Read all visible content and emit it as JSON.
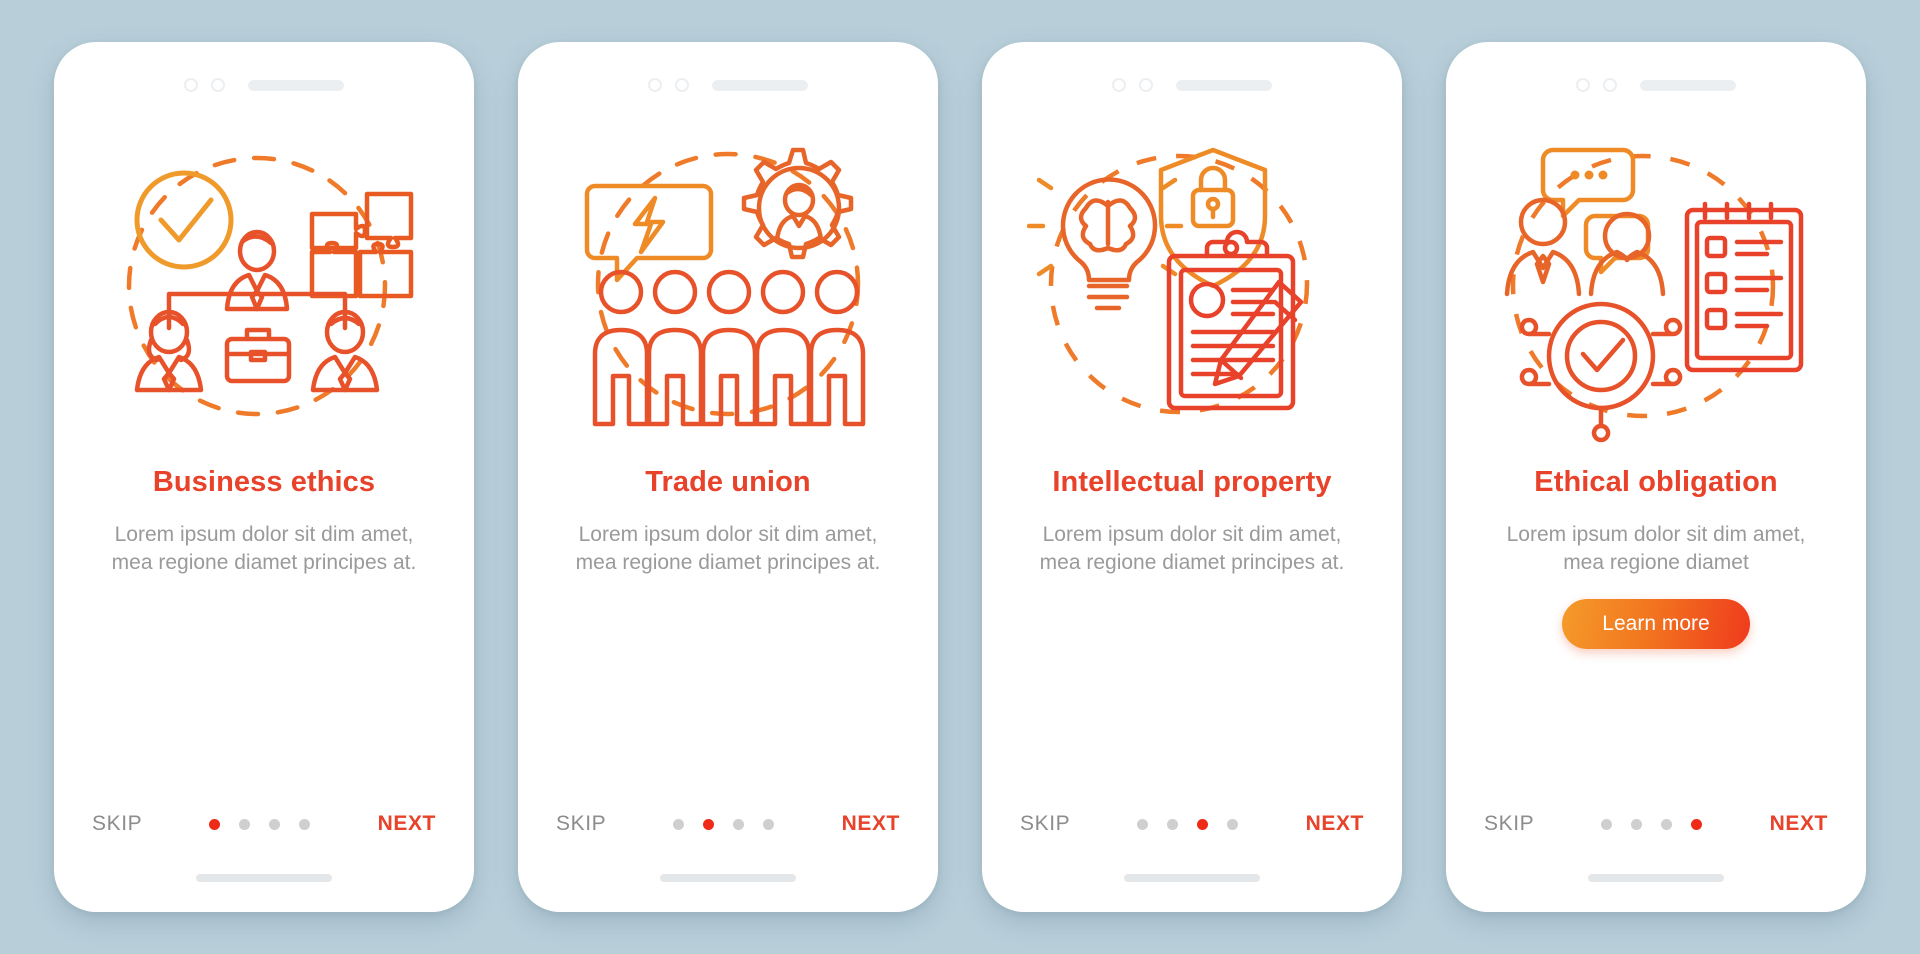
{
  "theme": {
    "background": "#b8cfda",
    "phone_bg": "#ffffff",
    "title_color": "#e8422b",
    "body_color": "#9a9a9a",
    "accent_red": "#ef2b17",
    "accent_orange": "#f59b2a",
    "dot_inactive": "#cfcfcf",
    "skip_color": "#8c8c8c"
  },
  "common": {
    "skip_label": "SKIP",
    "next_label": "NEXT",
    "body_text": "Lorem ipsum dolor sit dim amet, mea regione diamet principes at.",
    "body_text_short": "Lorem ipsum dolor sit dim amet, mea regione diamet",
    "dot_count": 4
  },
  "screens": [
    {
      "id": "business-ethics",
      "title": "Business ethics",
      "body": "Lorem ipsum dolor sit dim amet, mea regione diamet principes at.",
      "active_dot": 1,
      "skip_label": "SKIP",
      "next_label": "NEXT",
      "cta_label": null,
      "icon_name": "business-ethics-illustration"
    },
    {
      "id": "trade-union",
      "title": "Trade union",
      "body": "Lorem ipsum dolor sit dim amet, mea regione diamet principes at.",
      "active_dot": 2,
      "skip_label": "SKIP",
      "next_label": "NEXT",
      "cta_label": null,
      "icon_name": "trade-union-illustration"
    },
    {
      "id": "intellectual-property",
      "title": "Intellectual property",
      "body": "Lorem ipsum dolor sit dim amet, mea regione diamet principes at.",
      "active_dot": 3,
      "skip_label": "SKIP",
      "next_label": "NEXT",
      "cta_label": null,
      "icon_name": "intellectual-property-illustration"
    },
    {
      "id": "ethical-obligation",
      "title": "Ethical obligation",
      "body": "Lorem ipsum dolor sit dim amet, mea regione diamet",
      "active_dot": 4,
      "skip_label": "SKIP",
      "next_label": "NEXT",
      "cta_label": "Learn more",
      "icon_name": "ethical-obligation-illustration"
    }
  ]
}
